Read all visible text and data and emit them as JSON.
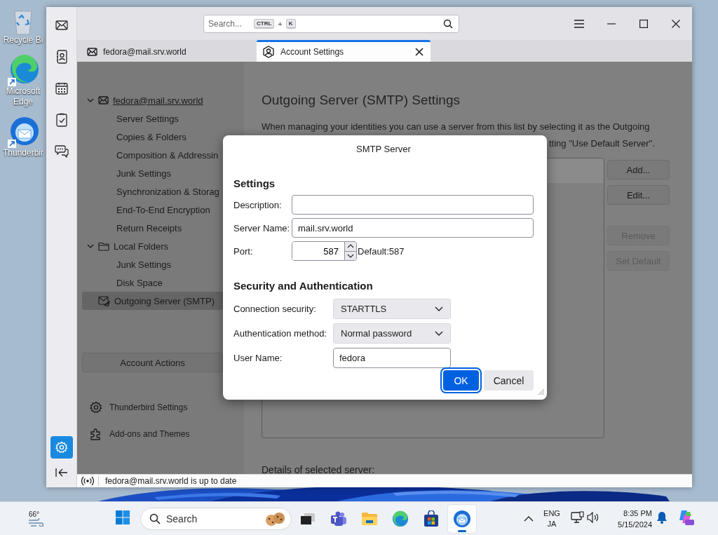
{
  "desktop": {
    "icons": [
      {
        "label": "Recycle Bi"
      },
      {
        "label": "Microsoft Edge"
      },
      {
        "label": "Thunderbir"
      }
    ]
  },
  "window": {
    "spaces_bar": {
      "items": [
        {
          "selected": false
        },
        {
          "selected": false
        },
        {
          "selected": false
        },
        {
          "selected": false
        },
        {
          "selected": false
        },
        {
          "selected": true
        }
      ]
    },
    "search": {
      "placeholder": "Search...",
      "shortcut": [
        "CTRL",
        "+",
        "K"
      ]
    },
    "tabs": [
      {
        "label": "fedora@mail.srv.world",
        "selected": false
      },
      {
        "label": "Account Settings",
        "selected": true
      }
    ],
    "account_tree": [
      {
        "kind": "account",
        "label": "fedora@mail.srv.world",
        "expanded": true,
        "selected": false,
        "children": [
          {
            "label": "Server Settings",
            "selected": false
          },
          {
            "label": "Copies & Folders",
            "selected": false
          },
          {
            "label": "Composition & Addressin",
            "selected": false
          },
          {
            "label": "Junk Settings",
            "selected": false
          },
          {
            "label": "Synchronization & Storag",
            "selected": false
          },
          {
            "label": "End-To-End Encryption",
            "selected": false
          },
          {
            "label": "Return Receipts",
            "selected": false
          }
        ]
      },
      {
        "kind": "local",
        "label": "Local Folders",
        "expanded": true,
        "selected": false,
        "children": [
          {
            "label": "Junk Settings",
            "selected": false
          },
          {
            "label": "Disk Space",
            "selected": false
          }
        ]
      },
      {
        "kind": "smtp",
        "label": "Outgoing Server (SMTP)",
        "selected": true
      }
    ],
    "account_actions": "Account Actions",
    "footer_links": [
      "Thunderbird Settings",
      "Add-ons and Themes"
    ],
    "panel": {
      "title": "Outgoing Server (SMTP) Settings",
      "description": "When managing your identities you can use a server from this list by selecting it as the Outgoing",
      "description_tail": "tting \"Use Default Server\".",
      "server_list": {
        "rows": [
          {
            "selected": true
          }
        ]
      },
      "buttons": [
        {
          "label": "Add...",
          "disabled": false
        },
        {
          "label": "Edit...",
          "disabled": false
        },
        {
          "label": "Remove",
          "disabled": true
        },
        {
          "label": "Set Default",
          "disabled": true
        }
      ],
      "details_heading": "Details of selected server:"
    },
    "status_bar": {
      "text": "fedora@mail.srv.world is up to date"
    }
  },
  "dialog": {
    "title": "SMTP Server",
    "settings_heading": "Settings",
    "description": {
      "label": "Description:"
    },
    "server_name": {
      "label": "Server Name:",
      "value": "mail.srv.world"
    },
    "port": {
      "label": "Port:",
      "value": "587",
      "default": "Default:587"
    },
    "security_heading": "Security and Authentication",
    "connection_security": {
      "label": "Connection security:",
      "value": "STARTTLS"
    },
    "auth_method": {
      "label": "Authentication method:",
      "value": "Normal password"
    },
    "user_name": {
      "label": "User Name:",
      "value": "fedora"
    },
    "buttons": [
      {
        "label": "OK",
        "kind": "primary"
      },
      {
        "label": "Cancel",
        "kind": "secondary"
      }
    ]
  },
  "taskbar": {
    "weather": "66°",
    "search_placeholder": "Search",
    "apps": [
      {
        "active": false
      },
      {
        "active": false
      },
      {
        "active": false
      },
      {
        "active": false
      },
      {
        "active": false
      },
      {
        "active": true
      }
    ],
    "language": [
      "ENG",
      "JA"
    ],
    "time": "8:35 PM",
    "date": "5/15/2024"
  }
}
